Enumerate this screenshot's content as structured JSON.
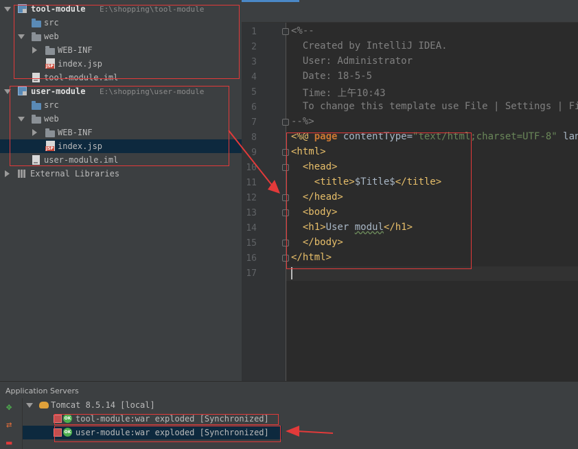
{
  "project_tree": {
    "modules": [
      {
        "name": "tool-module",
        "path": "E:\\shopping\\tool-module",
        "src": "src",
        "web": "web",
        "web_inf": "WEB-INF",
        "index": "index.jsp",
        "iml": "tool-module.iml"
      },
      {
        "name": "user-module",
        "path": "E:\\shopping\\user-module",
        "src": "src",
        "web": "web",
        "web_inf": "WEB-INF",
        "index": "index.jsp",
        "iml": "user-module.iml"
      }
    ],
    "external_libraries": "External Libraries"
  },
  "editor": {
    "line_numbers": [
      "1",
      "2",
      "3",
      "4",
      "5",
      "6",
      "7",
      "8",
      "9",
      "10",
      "11",
      "12",
      "13",
      "14",
      "15",
      "16",
      "17"
    ],
    "lines": {
      "l1": "<%--",
      "l2": "  Created by IntelliJ IDEA.",
      "l3": "  User: Administrator",
      "l4": "  Date: 18-5-5",
      "l5": "  Time: 上午10:43",
      "l6": "  To change this template use File | Settings | File",
      "l7": "--%>",
      "l8_open": "<%@ ",
      "l8_kw": "page",
      "l8_attr": " contentType=",
      "l8_str": "\"text/html;charset=UTF-8\"",
      "l8_rest": " langu",
      "l9": "<html>",
      "l10": "  <head>",
      "l11_open": "    <title>",
      "l11_text": "$Title$",
      "l11_close": "</title>",
      "l12": "  </head>",
      "l13": "  <body>",
      "l14_open": "  <h1>",
      "l14_text_a": "User ",
      "l14_text_b": "modul",
      "l14_close": "</h1>",
      "l15": "  </body>",
      "l16": "</html>"
    }
  },
  "servers": {
    "title": "Application Servers",
    "server": "Tomcat 8.5.14 [local]",
    "ok_badge": "OK",
    "artifacts": [
      "tool-module:war exploded [Synchronized]",
      "user-module:war exploded [Synchronized]"
    ],
    "toolbar": {
      "update": "update-icon",
      "deploy": "redeploy-icon",
      "remove": "remove-icon"
    }
  },
  "annotation_color": "#e33a3a",
  "selection_color": "#0d293e"
}
